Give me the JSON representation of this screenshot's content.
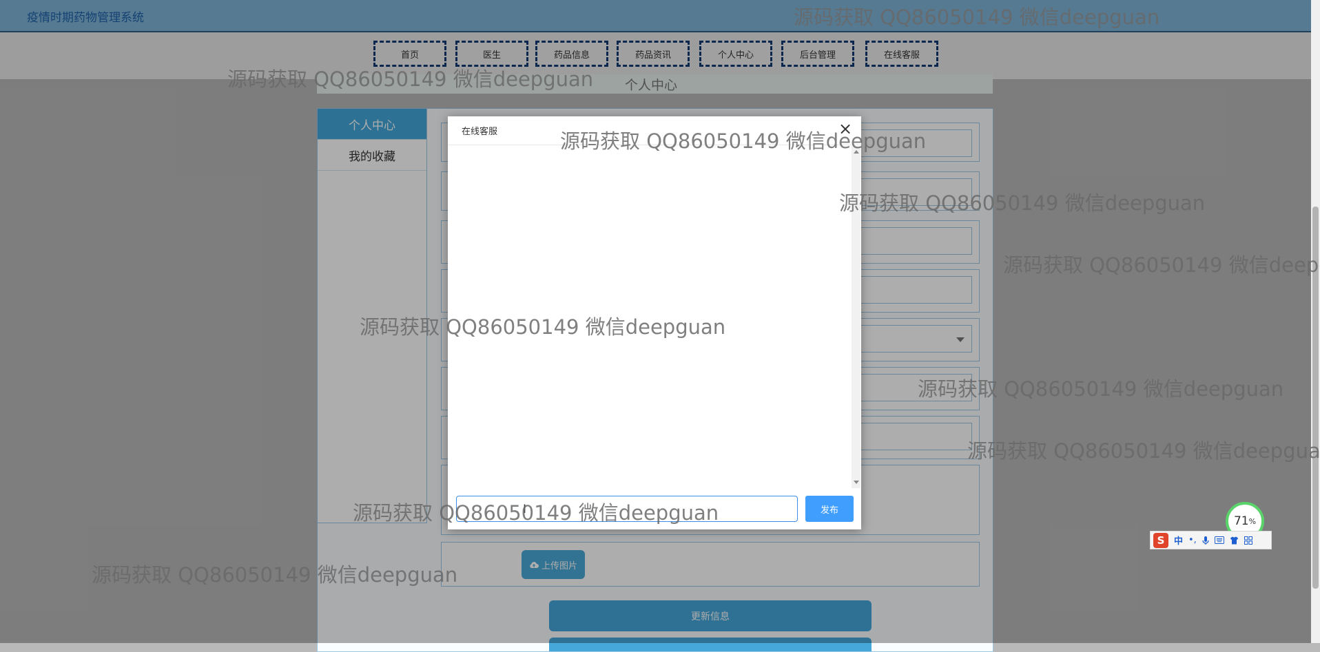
{
  "app": {
    "title": "疫情时期药物管理系统"
  },
  "nav": {
    "items": [
      {
        "label": "首页"
      },
      {
        "label": "医生"
      },
      {
        "label": "药品信息"
      },
      {
        "label": "药品资讯"
      },
      {
        "label": "个人中心"
      },
      {
        "label": "后台管理"
      },
      {
        "label": "在线客服"
      }
    ]
  },
  "page": {
    "title": "个人中心"
  },
  "sidebar": {
    "items": [
      {
        "label": "个人中心",
        "active": true
      },
      {
        "label": "我的收藏",
        "active": false
      }
    ]
  },
  "form": {
    "upload_label": "上传图片",
    "update_label": "更新信息"
  },
  "modal": {
    "title": "在线客服",
    "close_glyph": "×",
    "input_value": "",
    "publish_label": "发布"
  },
  "widgets": {
    "perf_value": "71",
    "perf_unit": "%",
    "ime_zh": "中",
    "ime_punct": "•,"
  },
  "watermark": {
    "text": "源码获取 QQ86050149 微信deepguan"
  },
  "colors": {
    "accent": "#43a7db",
    "publish": "#409eff",
    "nav_border": "#123a72"
  }
}
